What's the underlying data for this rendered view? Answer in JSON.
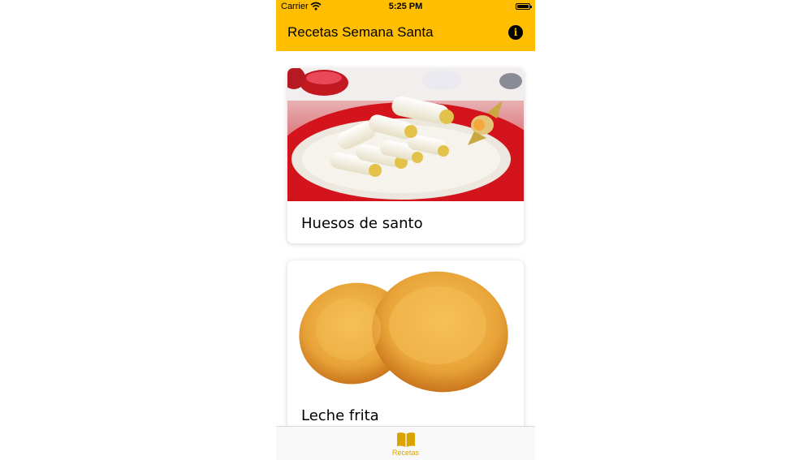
{
  "status_bar": {
    "carrier": "Carrier",
    "time": "5:25 PM"
  },
  "nav": {
    "title": "Recetas Semana Santa",
    "info_icon": "info-icon",
    "info_glyph": "i"
  },
  "cards": [
    {
      "title": "Huesos de santo",
      "image": "huesos-de-santo-photo"
    },
    {
      "title": "Leche frita",
      "image": "leche-frita-photo"
    }
  ],
  "tab_bar": {
    "items": [
      {
        "label": "Recetas",
        "icon": "book-icon",
        "selected": true
      }
    ]
  },
  "colors": {
    "accent": "#FFBF00",
    "tab_active": "#D9A400"
  }
}
